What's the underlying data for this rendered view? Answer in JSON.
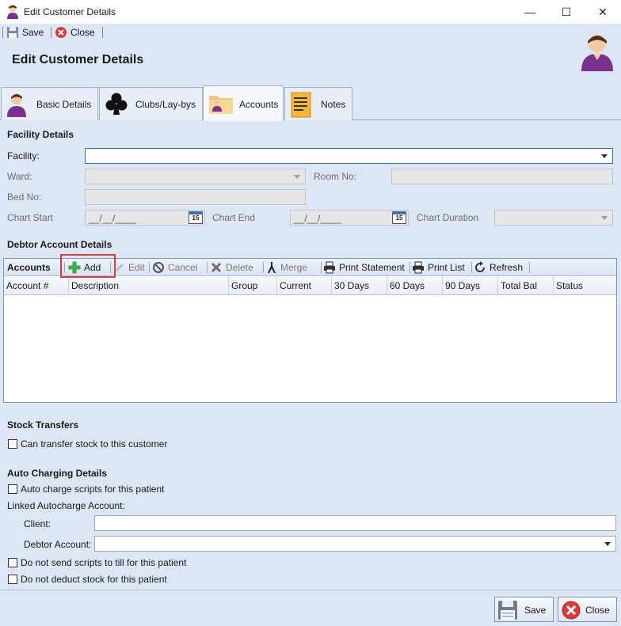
{
  "window": {
    "title": "Edit Customer Details",
    "controls": {
      "minimize": "—",
      "maximize": "☐",
      "close": "✕"
    }
  },
  "toolbar": {
    "save_label": "Save",
    "close_label": "Close"
  },
  "header": {
    "title": "Edit Customer Details"
  },
  "tabs": [
    {
      "label": "Basic Details",
      "icon": "person-icon"
    },
    {
      "label": "Clubs/Lay-bys",
      "icon": "clubs-icon"
    },
    {
      "label": "Accounts",
      "icon": "accounts-folder-icon",
      "active": true
    },
    {
      "label": "Notes",
      "icon": "notes-icon"
    }
  ],
  "facility": {
    "section_title": "Facility Details",
    "facility_label": "Facility:",
    "facility_value": "",
    "ward_label": "Ward:",
    "ward_value": "",
    "room_label": "Room No:",
    "room_value": "",
    "bed_label": "Bed No:",
    "bed_value": "",
    "chart_start_label": "Chart Start",
    "chart_start_value": "__/__/____",
    "chart_end_label": "Chart End",
    "chart_end_value": "__/__/____",
    "chart_duration_label": "Chart Duration",
    "chart_duration_value": "",
    "calendar_day": "15"
  },
  "debtor": {
    "section_title": "Debtor Account Details",
    "grid_title": "Accounts",
    "actions": {
      "add": "Add",
      "edit": "Edit",
      "cancel": "Cancel",
      "delete": "Delete",
      "merge": "Merge",
      "print_statement": "Print Statement",
      "print_list": "Print List",
      "refresh": "Refresh"
    },
    "columns": [
      "Account #",
      "Description",
      "Group",
      "Current",
      "30 Days",
      "60 Days",
      "90 Days",
      "Total Bal",
      "Status"
    ],
    "rows": []
  },
  "stock": {
    "section_title": "Stock Transfers",
    "transfer_label": "Can transfer stock to this customer",
    "transfer_checked": false
  },
  "autocharge": {
    "section_title": "Auto Charging Details",
    "auto_charge_label": "Auto charge scripts for this patient",
    "linked_label": "Linked Autocharge Account:",
    "client_label": "Client:",
    "client_value": "",
    "debtor_label": "Debtor Account:",
    "debtor_value": "",
    "no_send_label": "Do not send scripts to till for this patient",
    "no_deduct_label": "Do not deduct stock for this patient"
  },
  "footer": {
    "save_label": "Save",
    "close_label": "Close"
  },
  "colors": {
    "background": "#dce6f4",
    "accent": "#3c6db0",
    "highlight": "#e53935"
  }
}
